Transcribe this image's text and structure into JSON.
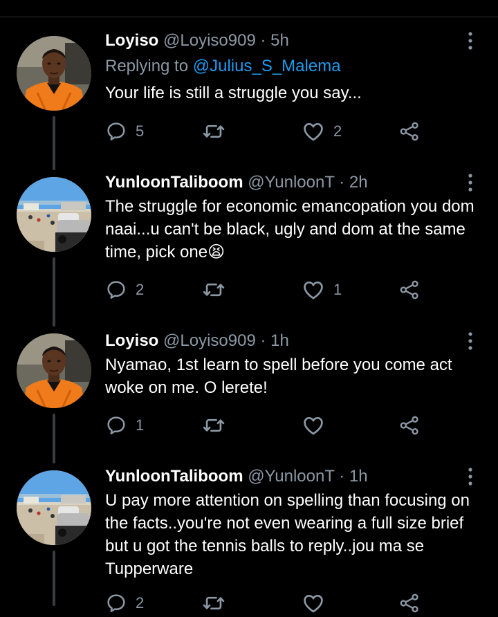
{
  "tweets": [
    {
      "name": "Loyiso",
      "handle": "@Loyiso909",
      "separator": "·",
      "time": "5h",
      "replying_prefix": "Replying to ",
      "replying_to": "@Julius_S_Malema",
      "text": "Your life is still a struggle you say...",
      "avatar": "person-orange-shirt",
      "reply_count": "5",
      "retweet_count": "",
      "like_count": "2"
    },
    {
      "name": "YunloonTaliboom",
      "handle": "@YunloonT",
      "separator": "·",
      "time": "2h",
      "text": "The struggle for economic emancopation you dom naai...u can't be black, ugly and dom at the same time, pick one😫",
      "avatar": "beach-scene",
      "reply_count": "2",
      "retweet_count": "",
      "like_count": "1"
    },
    {
      "name": "Loyiso",
      "handle": "@Loyiso909",
      "separator": "·",
      "time": "1h",
      "text": "Nyamao, 1st learn to spell before you come act woke on me. O lerete!",
      "avatar": "person-orange-shirt",
      "reply_count": "1",
      "retweet_count": "",
      "like_count": ""
    },
    {
      "name": "YunloonTaliboom",
      "handle": "@YunloonT",
      "separator": "·",
      "time": "1h",
      "text": "U pay more attention on spelling than focusing on the facts..you're not even wearing a full size brief but u got the tennis balls to reply..jou ma se Tupperware",
      "avatar": "beach-scene",
      "reply_count": "2",
      "retweet_count": "",
      "like_count": ""
    }
  ],
  "colors": {
    "background": "#000000",
    "secondary_text": "#8b98a5",
    "mention": "#1d9bf0",
    "thread_line": "#3a3d40"
  }
}
